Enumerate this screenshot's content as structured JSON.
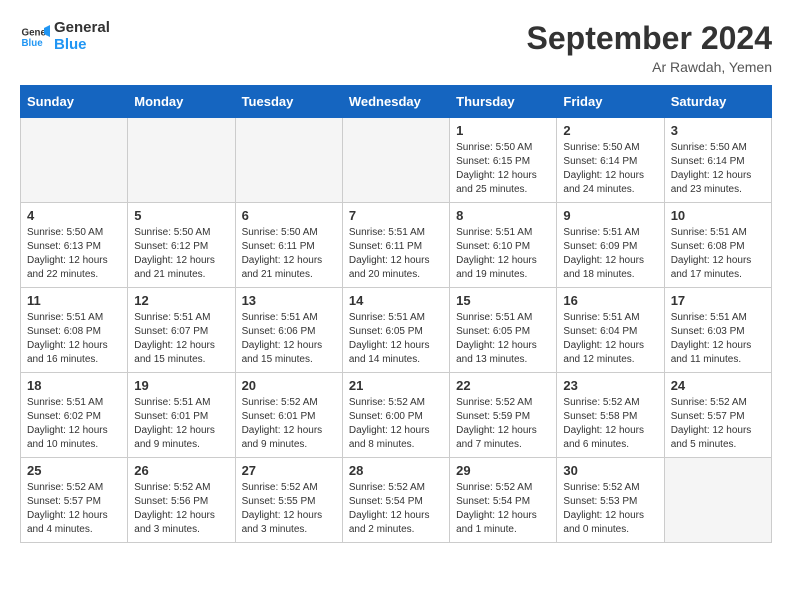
{
  "header": {
    "logo_line1": "General",
    "logo_line2": "Blue",
    "month": "September 2024",
    "location": "Ar Rawdah, Yemen"
  },
  "weekdays": [
    "Sunday",
    "Monday",
    "Tuesday",
    "Wednesday",
    "Thursday",
    "Friday",
    "Saturday"
  ],
  "days": [
    {
      "date": "",
      "info": ""
    },
    {
      "date": "",
      "info": ""
    },
    {
      "date": "",
      "info": ""
    },
    {
      "date": "",
      "info": ""
    },
    {
      "date": "1",
      "info": "Sunrise: 5:50 AM\nSunset: 6:15 PM\nDaylight: 12 hours\nand 25 minutes."
    },
    {
      "date": "2",
      "info": "Sunrise: 5:50 AM\nSunset: 6:14 PM\nDaylight: 12 hours\nand 24 minutes."
    },
    {
      "date": "3",
      "info": "Sunrise: 5:50 AM\nSunset: 6:14 PM\nDaylight: 12 hours\nand 23 minutes."
    },
    {
      "date": "4",
      "info": "Sunrise: 5:50 AM\nSunset: 6:13 PM\nDaylight: 12 hours\nand 22 minutes."
    },
    {
      "date": "5",
      "info": "Sunrise: 5:50 AM\nSunset: 6:12 PM\nDaylight: 12 hours\nand 21 minutes."
    },
    {
      "date": "6",
      "info": "Sunrise: 5:50 AM\nSunset: 6:11 PM\nDaylight: 12 hours\nand 21 minutes."
    },
    {
      "date": "7",
      "info": "Sunrise: 5:51 AM\nSunset: 6:11 PM\nDaylight: 12 hours\nand 20 minutes."
    },
    {
      "date": "8",
      "info": "Sunrise: 5:51 AM\nSunset: 6:10 PM\nDaylight: 12 hours\nand 19 minutes."
    },
    {
      "date": "9",
      "info": "Sunrise: 5:51 AM\nSunset: 6:09 PM\nDaylight: 12 hours\nand 18 minutes."
    },
    {
      "date": "10",
      "info": "Sunrise: 5:51 AM\nSunset: 6:08 PM\nDaylight: 12 hours\nand 17 minutes."
    },
    {
      "date": "11",
      "info": "Sunrise: 5:51 AM\nSunset: 6:08 PM\nDaylight: 12 hours\nand 16 minutes."
    },
    {
      "date": "12",
      "info": "Sunrise: 5:51 AM\nSunset: 6:07 PM\nDaylight: 12 hours\nand 15 minutes."
    },
    {
      "date": "13",
      "info": "Sunrise: 5:51 AM\nSunset: 6:06 PM\nDaylight: 12 hours\nand 15 minutes."
    },
    {
      "date": "14",
      "info": "Sunrise: 5:51 AM\nSunset: 6:05 PM\nDaylight: 12 hours\nand 14 minutes."
    },
    {
      "date": "15",
      "info": "Sunrise: 5:51 AM\nSunset: 6:05 PM\nDaylight: 12 hours\nand 13 minutes."
    },
    {
      "date": "16",
      "info": "Sunrise: 5:51 AM\nSunset: 6:04 PM\nDaylight: 12 hours\nand 12 minutes."
    },
    {
      "date": "17",
      "info": "Sunrise: 5:51 AM\nSunset: 6:03 PM\nDaylight: 12 hours\nand 11 minutes."
    },
    {
      "date": "18",
      "info": "Sunrise: 5:51 AM\nSunset: 6:02 PM\nDaylight: 12 hours\nand 10 minutes."
    },
    {
      "date": "19",
      "info": "Sunrise: 5:51 AM\nSunset: 6:01 PM\nDaylight: 12 hours\nand 9 minutes."
    },
    {
      "date": "20",
      "info": "Sunrise: 5:52 AM\nSunset: 6:01 PM\nDaylight: 12 hours\nand 9 minutes."
    },
    {
      "date": "21",
      "info": "Sunrise: 5:52 AM\nSunset: 6:00 PM\nDaylight: 12 hours\nand 8 minutes."
    },
    {
      "date": "22",
      "info": "Sunrise: 5:52 AM\nSunset: 5:59 PM\nDaylight: 12 hours\nand 7 minutes."
    },
    {
      "date": "23",
      "info": "Sunrise: 5:52 AM\nSunset: 5:58 PM\nDaylight: 12 hours\nand 6 minutes."
    },
    {
      "date": "24",
      "info": "Sunrise: 5:52 AM\nSunset: 5:57 PM\nDaylight: 12 hours\nand 5 minutes."
    },
    {
      "date": "25",
      "info": "Sunrise: 5:52 AM\nSunset: 5:57 PM\nDaylight: 12 hours\nand 4 minutes."
    },
    {
      "date": "26",
      "info": "Sunrise: 5:52 AM\nSunset: 5:56 PM\nDaylight: 12 hours\nand 3 minutes."
    },
    {
      "date": "27",
      "info": "Sunrise: 5:52 AM\nSunset: 5:55 PM\nDaylight: 12 hours\nand 3 minutes."
    },
    {
      "date": "28",
      "info": "Sunrise: 5:52 AM\nSunset: 5:54 PM\nDaylight: 12 hours\nand 2 minutes."
    },
    {
      "date": "29",
      "info": "Sunrise: 5:52 AM\nSunset: 5:54 PM\nDaylight: 12 hours\nand 1 minute."
    },
    {
      "date": "30",
      "info": "Sunrise: 5:52 AM\nSunset: 5:53 PM\nDaylight: 12 hours\nand 0 minutes."
    },
    {
      "date": "",
      "info": ""
    },
    {
      "date": "",
      "info": ""
    },
    {
      "date": "",
      "info": ""
    },
    {
      "date": "",
      "info": ""
    },
    {
      "date": "",
      "info": ""
    }
  ]
}
